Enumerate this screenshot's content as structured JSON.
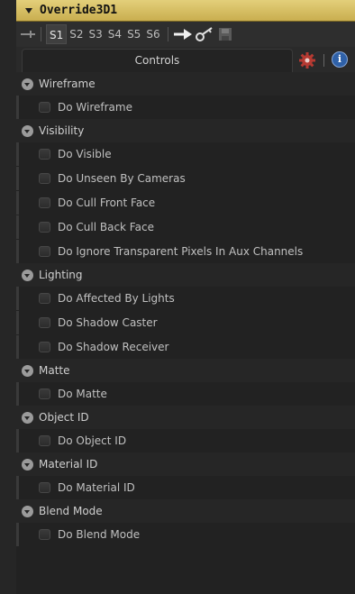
{
  "header": {
    "title": "Override3D1"
  },
  "toolbar": {
    "slots": [
      "S1",
      "S2",
      "S3",
      "S4",
      "S5",
      "S6"
    ],
    "active_slot": "S1"
  },
  "tabs": {
    "controls_label": "Controls",
    "settings_icon": "gear-icon",
    "info_icon": "info-icon",
    "info_glyph": "i"
  },
  "colors": {
    "title_bar": "#d8c266",
    "info_blue": "#2f61a8",
    "gear_red": "#b63a32"
  },
  "sections": [
    {
      "label": "Wireframe",
      "items": [
        "Do Wireframe"
      ]
    },
    {
      "label": "Visibility",
      "items": [
        "Do Visible",
        "Do Unseen By Cameras",
        "Do Cull Front Face",
        "Do Cull Back Face",
        "Do Ignore Transparent Pixels In Aux Channels"
      ]
    },
    {
      "label": "Lighting",
      "items": [
        "Do Affected By Lights",
        "Do Shadow Caster",
        "Do Shadow Receiver"
      ]
    },
    {
      "label": "Matte",
      "items": [
        "Do Matte"
      ]
    },
    {
      "label": "Object ID",
      "items": [
        "Do Object ID"
      ]
    },
    {
      "label": "Material ID",
      "items": [
        "Do Material ID"
      ]
    },
    {
      "label": "Blend Mode",
      "items": [
        "Do Blend Mode"
      ]
    }
  ]
}
